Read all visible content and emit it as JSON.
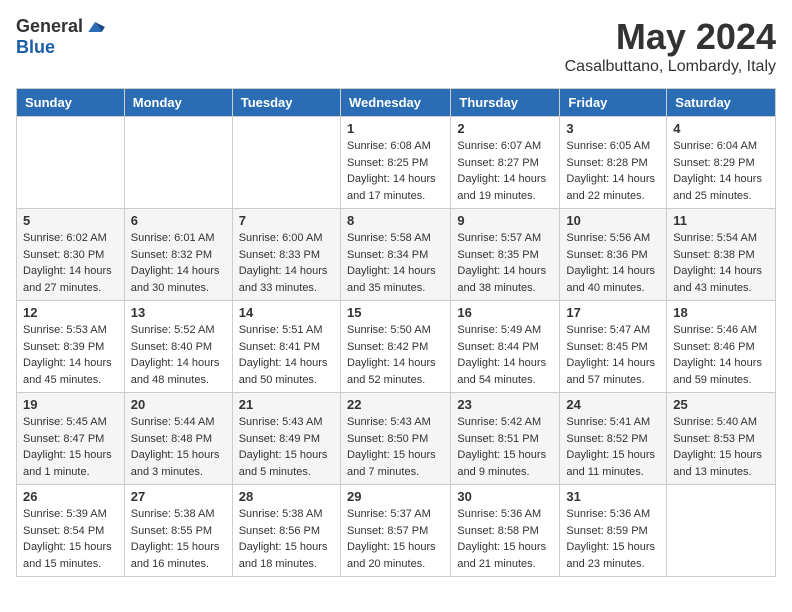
{
  "header": {
    "logo_general": "General",
    "logo_blue": "Blue",
    "month_year": "May 2024",
    "location": "Casalbuttano, Lombardy, Italy"
  },
  "weekdays": [
    "Sunday",
    "Monday",
    "Tuesday",
    "Wednesday",
    "Thursday",
    "Friday",
    "Saturday"
  ],
  "weeks": [
    [
      {
        "day": "",
        "info": ""
      },
      {
        "day": "",
        "info": ""
      },
      {
        "day": "",
        "info": ""
      },
      {
        "day": "1",
        "info": "Sunrise: 6:08 AM\nSunset: 8:25 PM\nDaylight: 14 hours and 17 minutes."
      },
      {
        "day": "2",
        "info": "Sunrise: 6:07 AM\nSunset: 8:27 PM\nDaylight: 14 hours and 19 minutes."
      },
      {
        "day": "3",
        "info": "Sunrise: 6:05 AM\nSunset: 8:28 PM\nDaylight: 14 hours and 22 minutes."
      },
      {
        "day": "4",
        "info": "Sunrise: 6:04 AM\nSunset: 8:29 PM\nDaylight: 14 hours and 25 minutes."
      }
    ],
    [
      {
        "day": "5",
        "info": "Sunrise: 6:02 AM\nSunset: 8:30 PM\nDaylight: 14 hours and 27 minutes."
      },
      {
        "day": "6",
        "info": "Sunrise: 6:01 AM\nSunset: 8:32 PM\nDaylight: 14 hours and 30 minutes."
      },
      {
        "day": "7",
        "info": "Sunrise: 6:00 AM\nSunset: 8:33 PM\nDaylight: 14 hours and 33 minutes."
      },
      {
        "day": "8",
        "info": "Sunrise: 5:58 AM\nSunset: 8:34 PM\nDaylight: 14 hours and 35 minutes."
      },
      {
        "day": "9",
        "info": "Sunrise: 5:57 AM\nSunset: 8:35 PM\nDaylight: 14 hours and 38 minutes."
      },
      {
        "day": "10",
        "info": "Sunrise: 5:56 AM\nSunset: 8:36 PM\nDaylight: 14 hours and 40 minutes."
      },
      {
        "day": "11",
        "info": "Sunrise: 5:54 AM\nSunset: 8:38 PM\nDaylight: 14 hours and 43 minutes."
      }
    ],
    [
      {
        "day": "12",
        "info": "Sunrise: 5:53 AM\nSunset: 8:39 PM\nDaylight: 14 hours and 45 minutes."
      },
      {
        "day": "13",
        "info": "Sunrise: 5:52 AM\nSunset: 8:40 PM\nDaylight: 14 hours and 48 minutes."
      },
      {
        "day": "14",
        "info": "Sunrise: 5:51 AM\nSunset: 8:41 PM\nDaylight: 14 hours and 50 minutes."
      },
      {
        "day": "15",
        "info": "Sunrise: 5:50 AM\nSunset: 8:42 PM\nDaylight: 14 hours and 52 minutes."
      },
      {
        "day": "16",
        "info": "Sunrise: 5:49 AM\nSunset: 8:44 PM\nDaylight: 14 hours and 54 minutes."
      },
      {
        "day": "17",
        "info": "Sunrise: 5:47 AM\nSunset: 8:45 PM\nDaylight: 14 hours and 57 minutes."
      },
      {
        "day": "18",
        "info": "Sunrise: 5:46 AM\nSunset: 8:46 PM\nDaylight: 14 hours and 59 minutes."
      }
    ],
    [
      {
        "day": "19",
        "info": "Sunrise: 5:45 AM\nSunset: 8:47 PM\nDaylight: 15 hours and 1 minute."
      },
      {
        "day": "20",
        "info": "Sunrise: 5:44 AM\nSunset: 8:48 PM\nDaylight: 15 hours and 3 minutes."
      },
      {
        "day": "21",
        "info": "Sunrise: 5:43 AM\nSunset: 8:49 PM\nDaylight: 15 hours and 5 minutes."
      },
      {
        "day": "22",
        "info": "Sunrise: 5:43 AM\nSunset: 8:50 PM\nDaylight: 15 hours and 7 minutes."
      },
      {
        "day": "23",
        "info": "Sunrise: 5:42 AM\nSunset: 8:51 PM\nDaylight: 15 hours and 9 minutes."
      },
      {
        "day": "24",
        "info": "Sunrise: 5:41 AM\nSunset: 8:52 PM\nDaylight: 15 hours and 11 minutes."
      },
      {
        "day": "25",
        "info": "Sunrise: 5:40 AM\nSunset: 8:53 PM\nDaylight: 15 hours and 13 minutes."
      }
    ],
    [
      {
        "day": "26",
        "info": "Sunrise: 5:39 AM\nSunset: 8:54 PM\nDaylight: 15 hours and 15 minutes."
      },
      {
        "day": "27",
        "info": "Sunrise: 5:38 AM\nSunset: 8:55 PM\nDaylight: 15 hours and 16 minutes."
      },
      {
        "day": "28",
        "info": "Sunrise: 5:38 AM\nSunset: 8:56 PM\nDaylight: 15 hours and 18 minutes."
      },
      {
        "day": "29",
        "info": "Sunrise: 5:37 AM\nSunset: 8:57 PM\nDaylight: 15 hours and 20 minutes."
      },
      {
        "day": "30",
        "info": "Sunrise: 5:36 AM\nSunset: 8:58 PM\nDaylight: 15 hours and 21 minutes."
      },
      {
        "day": "31",
        "info": "Sunrise: 5:36 AM\nSunset: 8:59 PM\nDaylight: 15 hours and 23 minutes."
      },
      {
        "day": "",
        "info": ""
      }
    ]
  ]
}
